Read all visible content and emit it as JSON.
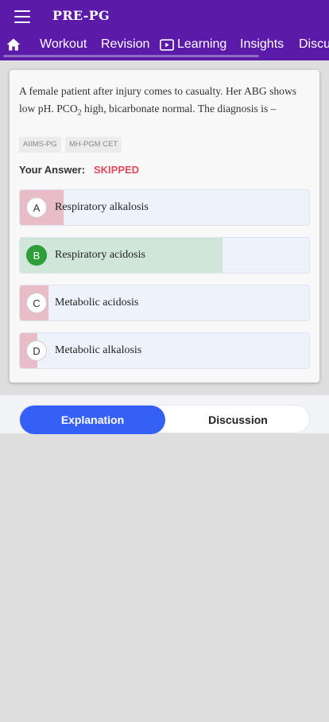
{
  "app": {
    "title": "PRE-PG"
  },
  "tabs": [
    {
      "label": "Workout"
    },
    {
      "label": "Revision"
    },
    {
      "label": "Learning"
    },
    {
      "label": "Insights"
    },
    {
      "label": "Discu"
    }
  ],
  "question": {
    "text_before_sub": "A female patient after injury comes to casualty. Her ABG shows low pH. PCO",
    "sub": "2",
    "text_after_sub": " high, bicarbonate normal. The diagnosis is –",
    "tags": [
      "AIIMS-PG",
      "MH-PGM CET"
    ],
    "your_answer_label": "Your Answer:",
    "answer_status": "SKIPPED",
    "options": [
      {
        "letter": "A",
        "label": "Respiratory alkalosis",
        "percent": 15,
        "correct": false
      },
      {
        "letter": "B",
        "label": "Respiratory acidosis",
        "percent": 70,
        "correct": true
      },
      {
        "letter": "C",
        "label": "Metabolic acidosis",
        "percent": 10,
        "correct": false
      },
      {
        "letter": "D",
        "label": "Metabolic alkalosis",
        "percent": 6,
        "correct": false
      }
    ]
  },
  "bottom_tabs": {
    "active": "Explanation",
    "inactive": "Discussion"
  },
  "colors": {
    "appbar": "#5b1aa8",
    "wrong_fill": "#e8bdc8",
    "correct_fill": "#cfe6d9",
    "status_skipped": "#e04a5a",
    "accent": "#3460f6"
  }
}
